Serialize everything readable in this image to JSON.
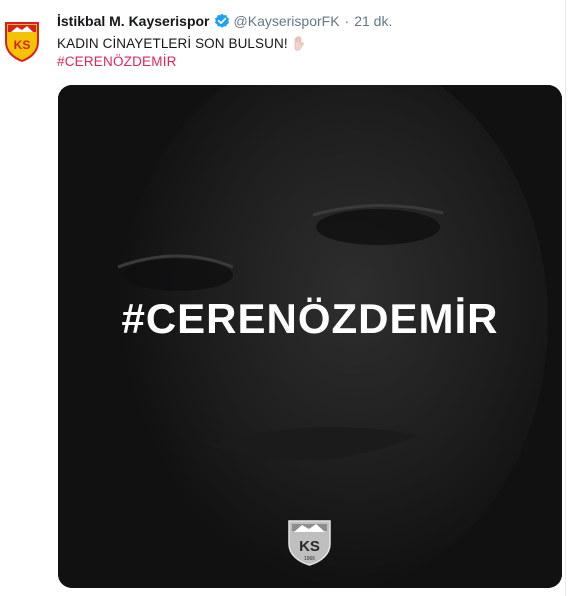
{
  "tweet": {
    "account_name": "İstikbal M. Kayserispor",
    "handle": "@KayserisporFK",
    "separator": "·",
    "time": "21 dk.",
    "text_line1": "KADIN CİNAYETLERİ SON BULSUN!",
    "emoji": "raised-hand-emoji",
    "hashtag": "#CERENÖZDEMİR",
    "verified_icon": "verified-badge-icon",
    "avatar_icon": "kayserispor-logo-icon"
  },
  "media": {
    "overlay_text": "#CERENÖZDEMİR",
    "logo_icon": "kayserispor-logo-icon",
    "logo_text": "KS",
    "logo_year": "1966"
  },
  "colors": {
    "name": "#14171a",
    "meta": "#657786",
    "hashtag_link": "#e0245e",
    "verified": "#1da1f2",
    "media_bg": "#111112",
    "club_yellow": "#f5c400",
    "club_red": "#d91f26"
  }
}
